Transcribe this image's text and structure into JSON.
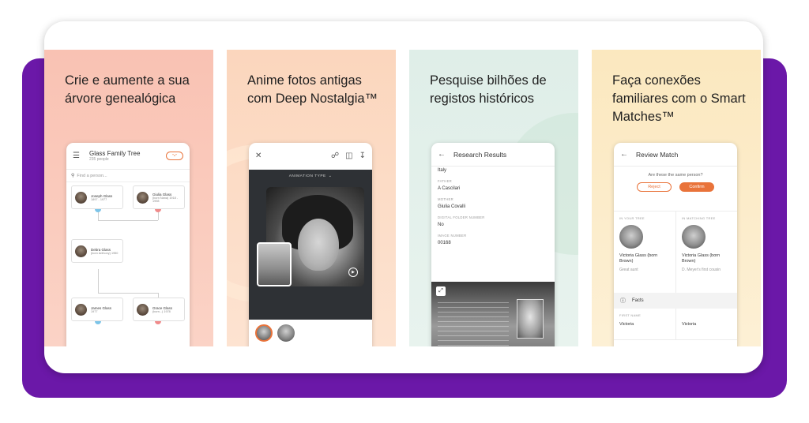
{
  "panels": [
    {
      "heading": "Crie e aumente a sua árvore genealógica"
    },
    {
      "heading": "Anime fotos antigas com Deep Nostalgia™"
    },
    {
      "heading": "Pesquise bilhões de registos históricos"
    },
    {
      "heading": "Faça conexões familiares com o Smart Matches™"
    }
  ],
  "tree": {
    "title": "Glass Family Tree",
    "subtitle": "235 people",
    "toggle": "\"•\"",
    "search_placeholder": "Find a person...",
    "people": [
      {
        "name": "Joseph Glass",
        "dates": "1897 - 1977"
      },
      {
        "name": "Giulia Glass",
        "dates": "(born Nana) 1918 - 1998"
      },
      {
        "name": "Debra Glass",
        "dates": "(born Anthony) 1950"
      },
      {
        "name": "James Glass",
        "dates": "1977"
      },
      {
        "name": "Grace Glass",
        "dates": "(born...) 1978"
      }
    ]
  },
  "animate": {
    "animation_type": "ANIMATION TYPE"
  },
  "research": {
    "title": "Research Results",
    "fields": [
      {
        "label": "",
        "value": "Italy"
      },
      {
        "label": "FATHER",
        "value": "A Cascilari"
      },
      {
        "label": "MOTHER",
        "value": "Giulia Covalli"
      },
      {
        "label": "DIGITAL FOLDER NUMBER",
        "value": "No"
      },
      {
        "label": "IMAGE NUMBER",
        "value": "00168"
      }
    ]
  },
  "match": {
    "title": "Review Match",
    "question": "Are these the same person?",
    "reject": "Reject",
    "confirm": "Confirm",
    "left": {
      "heading": "IN YOUR TREE",
      "name": "Victoria Glass (born Brown)",
      "sub": "Great aunt"
    },
    "right": {
      "heading": "IN MATCHING TREE",
      "name": "Victoria Glass (born Brown)",
      "sub": "D. Meyer's first cousin"
    },
    "facts_label": "Facts",
    "fact": {
      "label": "FIRST NAME",
      "left_value": "Victoria",
      "right_value": "Victoria"
    }
  },
  "colors": {
    "purple": "#6b18a8",
    "accent_orange": "#e9733a"
  }
}
